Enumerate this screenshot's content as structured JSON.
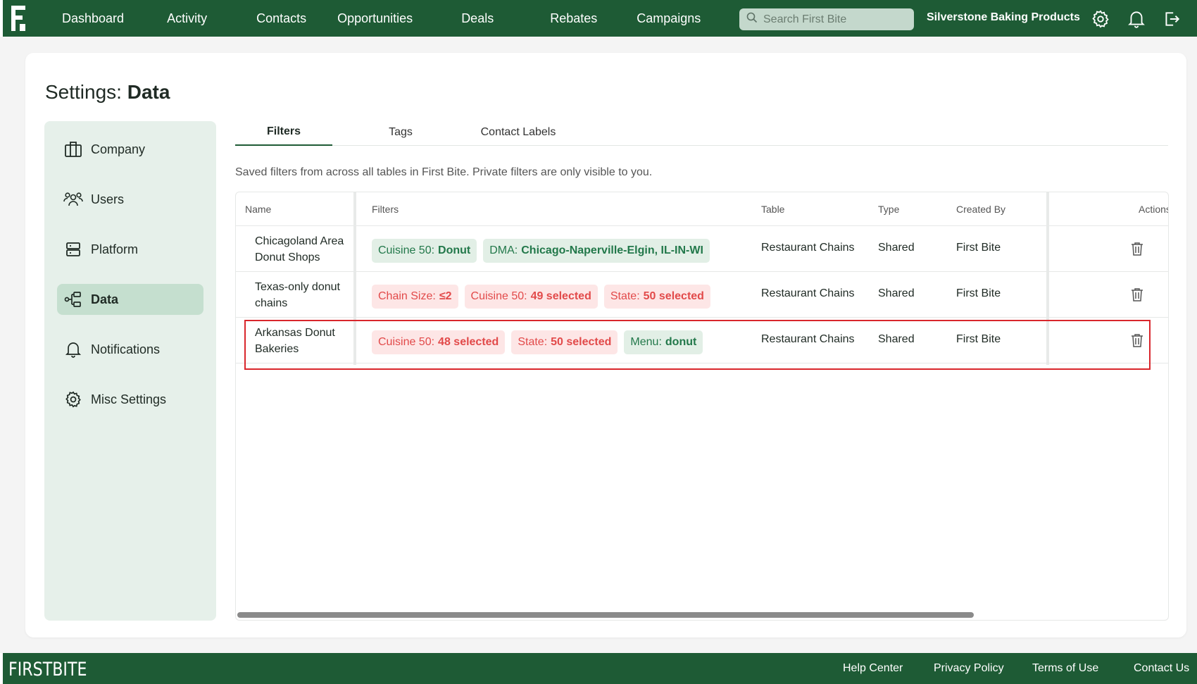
{
  "nav": {
    "links": [
      "Dashboard",
      "Activity",
      "Contacts",
      "Opportunities",
      "Deals",
      "Rebates",
      "Campaigns"
    ],
    "search_placeholder": "Search First Bite",
    "company": "Silverstone Baking Products",
    "icons": [
      "gear-icon",
      "bell-icon",
      "logout-icon"
    ]
  },
  "page": {
    "title_prefix": "Settings:",
    "title_main": "Data",
    "description": "Saved filters from across all tables in First Bite. Private filters are only visible to you."
  },
  "sidebar": {
    "items": [
      {
        "label": "Company",
        "icon": "building-icon"
      },
      {
        "label": "Users",
        "icon": "users-icon"
      },
      {
        "label": "Platform",
        "icon": "server-icon"
      },
      {
        "label": "Data",
        "icon": "data-icon",
        "active": true
      },
      {
        "label": "Notifications",
        "icon": "bell-icon"
      },
      {
        "label": "Misc Settings",
        "icon": "gear-icon"
      }
    ]
  },
  "tabs": [
    {
      "label": "Filters",
      "active": true
    },
    {
      "label": "Tags"
    },
    {
      "label": "Contact Labels"
    }
  ],
  "table": {
    "headers": {
      "name": "Name",
      "filters": "Filters",
      "table": "Table",
      "type": "Type",
      "created_by": "Created By",
      "actions": "Actions"
    },
    "rows": [
      {
        "name": "Chicagoland Area Donut Shops",
        "chips": [
          {
            "key": "Cuisine 50:",
            "value": "Donut",
            "color": "green"
          },
          {
            "key": "DMA:",
            "value": "Chicago-Naperville-Elgin, IL-IN-WI",
            "color": "green"
          }
        ],
        "table": "Restaurant Chains",
        "type": "Shared",
        "created_by": "First Bite"
      },
      {
        "name": "Texas-only donut chains",
        "chips": [
          {
            "key": "Chain Size:",
            "value": "≤2",
            "color": "red"
          },
          {
            "key": "Cuisine 50:",
            "value": "49 selected",
            "color": "red"
          },
          {
            "key": "State:",
            "value": "50 selected",
            "color": "red"
          }
        ],
        "table": "Restaurant Chains",
        "type": "Shared",
        "created_by": "First Bite"
      },
      {
        "name": "Arkansas Donut Bakeries",
        "chips": [
          {
            "key": "Cuisine 50:",
            "value": "48 selected",
            "color": "red"
          },
          {
            "key": "State:",
            "value": "50 selected",
            "color": "red"
          },
          {
            "key": "Menu:",
            "value": "donut",
            "color": "green"
          }
        ],
        "table": "Restaurant Chains",
        "type": "Shared",
        "created_by": "First Bite",
        "highlighted": true
      }
    ]
  },
  "footer": {
    "logo": "FIRSTBITE",
    "links": [
      "Help Center",
      "Privacy Policy",
      "Terms of Use",
      "Contact Us"
    ]
  },
  "colors": {
    "brand_green": "#1e5b35",
    "sidebar_bg": "#e6f0ea",
    "chip_green_text": "#22784a",
    "chip_red_text": "#e24a4a",
    "highlight_border": "#d9262c"
  }
}
